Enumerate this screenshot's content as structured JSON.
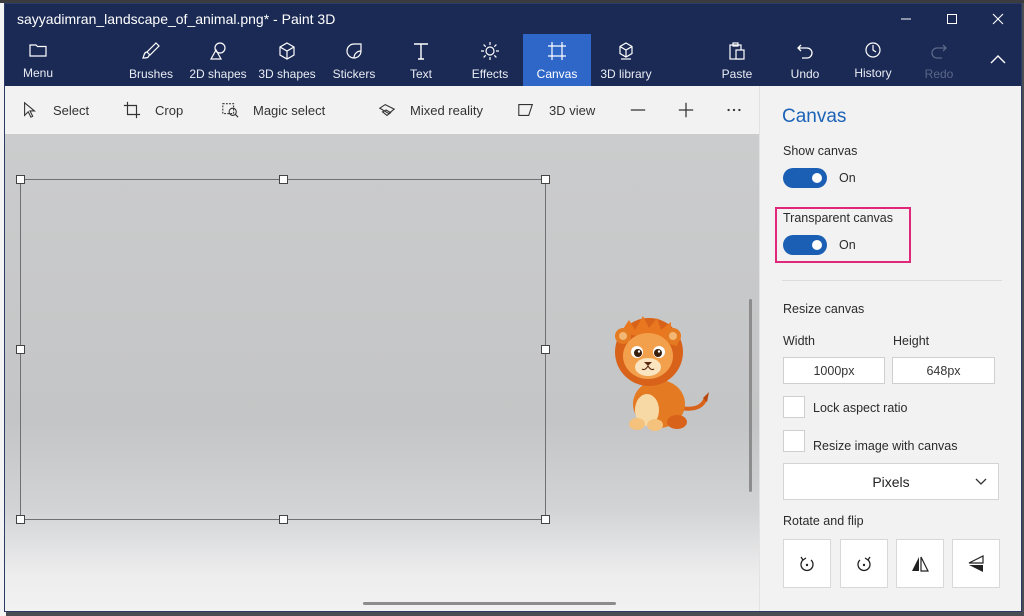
{
  "window": {
    "title": "sayyadimran_landscape_of_animal.png* - Paint 3D"
  },
  "ribbon": {
    "menu": "Menu",
    "brushes": "Brushes",
    "shapes2d": "2D shapes",
    "shapes3d": "3D shapes",
    "stickers": "Stickers",
    "text": "Text",
    "effects": "Effects",
    "canvas": "Canvas",
    "library3d": "3D library",
    "paste": "Paste",
    "undo": "Undo",
    "history": "History",
    "redo": "Redo"
  },
  "toolbar": {
    "select": "Select",
    "crop": "Crop",
    "magic_select": "Magic select",
    "mixed_reality": "Mixed reality",
    "view3d": "3D view"
  },
  "panel": {
    "title": "Canvas",
    "show_canvas_label": "Show canvas",
    "show_canvas_state": "On",
    "transparent_label": "Transparent canvas",
    "transparent_state": "On",
    "resize_label": "Resize canvas",
    "width_label": "Width",
    "height_label": "Height",
    "width_value": "1000px",
    "height_value": "648px",
    "lock_aspect": "Lock aspect ratio",
    "resize_with_canvas": "Resize image with canvas",
    "units": "Pixels",
    "rotate_label": "Rotate and flip"
  },
  "icons": {
    "ribbon": [
      "menu-icon",
      "brush-icon",
      "shapes-2d-icon",
      "cube-icon",
      "sticker-icon",
      "text-icon",
      "effects-icon",
      "canvas-icon",
      "library-3d-icon",
      "paste-icon",
      "undo-icon",
      "history-icon",
      "redo-icon",
      "collapse-icon"
    ],
    "rotate": [
      "rotate-left-icon",
      "rotate-right-icon",
      "flip-horizontal-icon",
      "flip-vertical-icon"
    ]
  },
  "colors": {
    "titlebar": "#1b2a55",
    "active_tab": "#2f67c9",
    "accent": "#1a5fb4",
    "highlight_box": "#e0287a"
  }
}
